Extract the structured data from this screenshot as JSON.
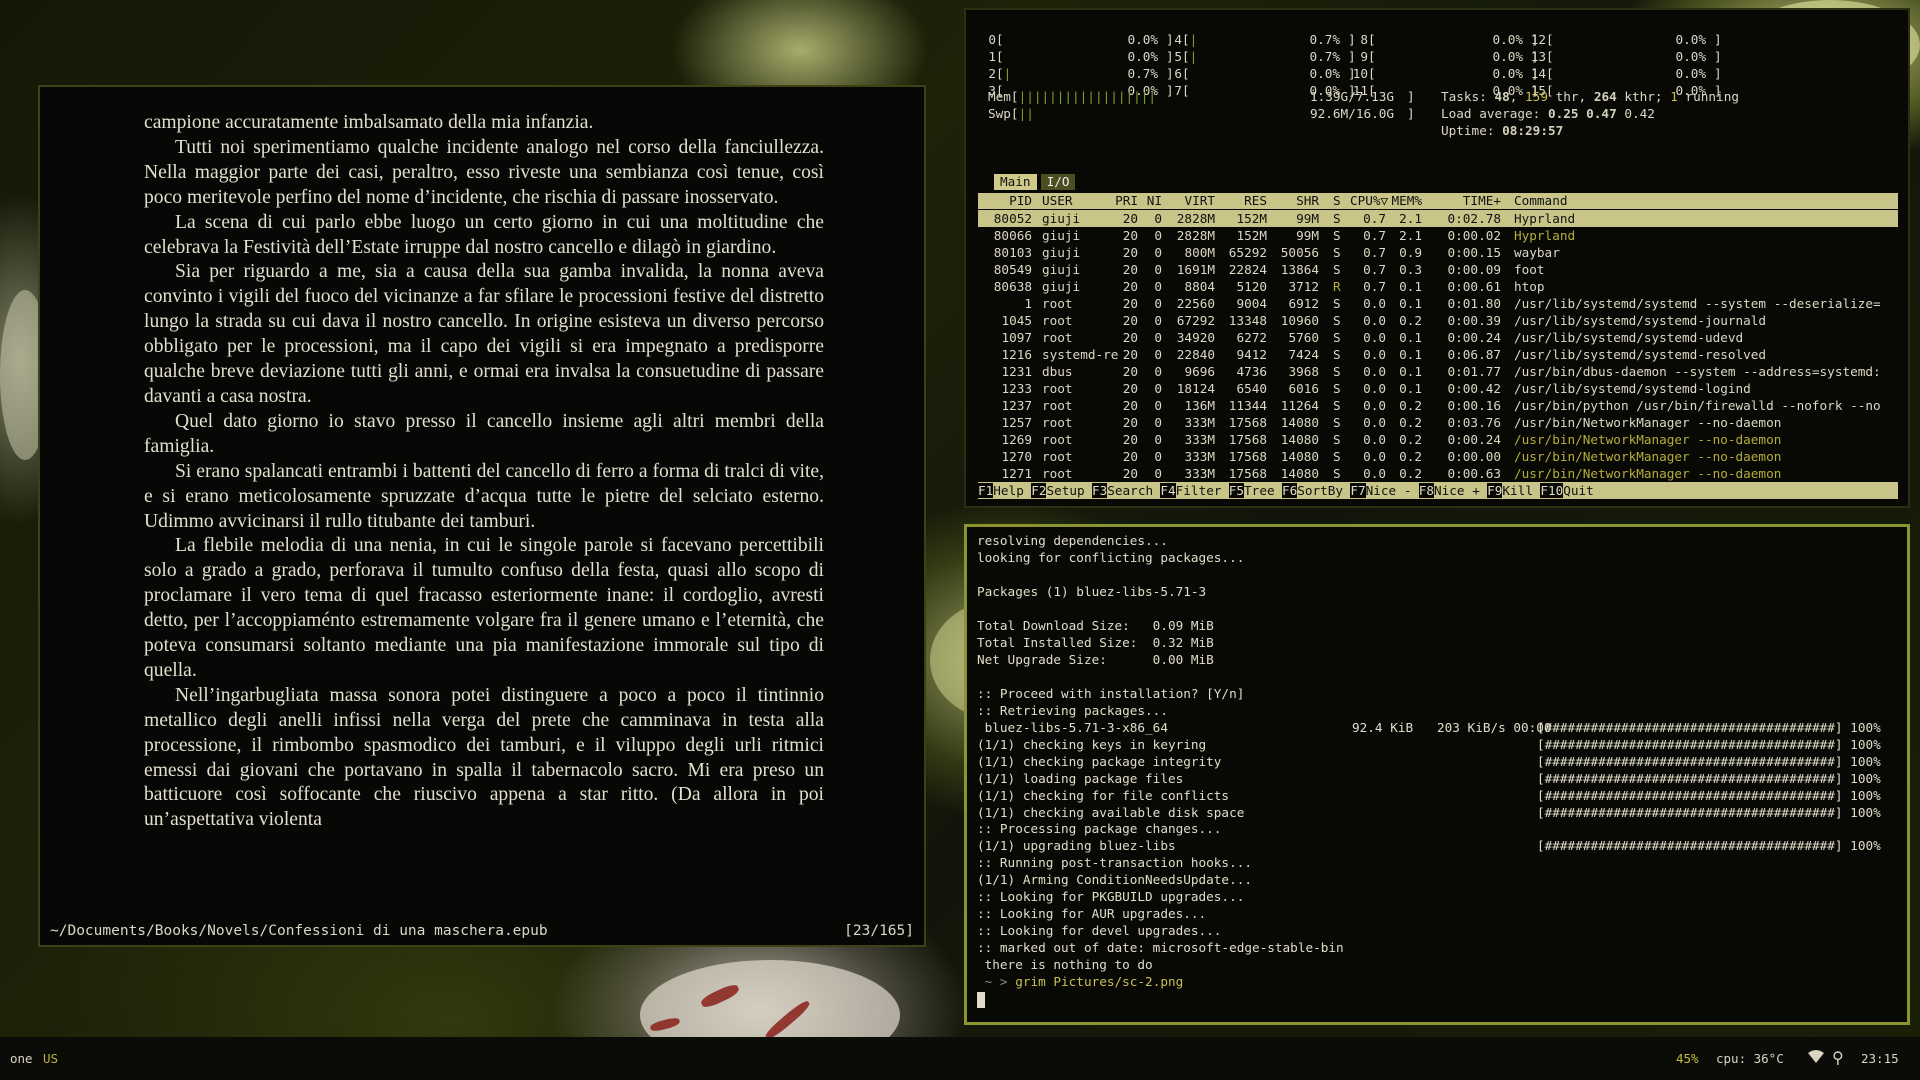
{
  "reader": {
    "paragraphs": [
      "campione accuratamente imbalsamato della mia infanzia.",
      "Tutti noi sperimentiamo qualche incidente analogo nel corso della fanciullezza. Nella maggior parte dei casi, peraltro, esso riveste una sembianza così tenue, così poco meritevole perfino del nome d’incidente, che rischia di passare inosservato.",
      "La scena di cui parlo ebbe luogo un certo giorno in cui una moltitudine che celebrava la Festività dell’Estate irruppe dal nostro cancello e dilagò in giardino.",
      "Sia per riguardo a me, sia a causa della sua gamba invalida, la nonna aveva convinto i vigili del fuoco del vicinanze a far sfilare le processioni festive del distretto lungo la strada su cui dava il nostro cancello. In origine esisteva un diverso percorso obbligato per le processioni, ma il capo dei vigili si era impegnato a predisporre qualche breve deviazione tutti gli anni, e ormai era invalsa la consuetudine di passare davanti a casa nostra.",
      "Quel dato giorno io stavo presso il cancello insieme agli altri membri della famiglia.",
      "Si erano spalancati entrambi i battenti del cancello di ferro a forma di tralci di vite, e si erano meticolosamente spruzzate d’acqua tutte le pietre del selciato esterno. Udimmo avvicinarsi il rullo titubante dei tamburi.",
      "La flebile melodia di una nenia, in cui le singole parole si facevano percettibili solo a grado a grado, perforava il tumulto confuso della festa, quasi allo scopo di proclamare il vero tema di quel fracasso esteriormente inane: il cordoglio, avresti detto, per l’accoppiaménto estremamente volgare fra il genere umano e l’eternità, che poteva consumarsi soltanto mediante una pia manifestazione immorale sul tipo di quella.",
      "Nell’ingarbugliata massa sonora potei distinguere a poco a poco il tintinnio metallico degli anelli infissi nella verga del prete che camminava in testa alla processione, il rimbombo spasmodico dei tamburi, e il viluppo degli urli ritmici emessi dai giovani che portavano in spalla il tabernacolo sacro. Mi era preso un batticuore così soffocante che riuscivo appena a star ritto. (Da allora in poi un’aspettativa violenta"
    ],
    "path": "~/Documents/Books/Novels/Confessioni di una maschera.epub",
    "page": "[23/165]"
  },
  "htop": {
    "cpus": [
      {
        "id": "0",
        "pct": "0.0%",
        "bar": ""
      },
      {
        "id": "1",
        "pct": "0.0%",
        "bar": ""
      },
      {
        "id": "2",
        "pct": "0.7%",
        "bar": "|"
      },
      {
        "id": "3",
        "pct": "0.0%",
        "bar": ""
      },
      {
        "id": "4",
        "pct": "0.7%",
        "bar": "|"
      },
      {
        "id": "5",
        "pct": "0.7%",
        "bar": "|"
      },
      {
        "id": "6",
        "pct": "0.0%",
        "bar": ""
      },
      {
        "id": "7",
        "pct": "0.0%",
        "bar": ""
      },
      {
        "id": "8",
        "pct": "0.0%",
        "bar": ""
      },
      {
        "id": "9",
        "pct": "0.0%",
        "bar": ""
      },
      {
        "id": "10",
        "pct": "0.0%",
        "bar": ""
      },
      {
        "id": "11",
        "pct": "0.0%",
        "bar": ""
      },
      {
        "id": "12",
        "pct": "0.0%",
        "bar": ""
      },
      {
        "id": "13",
        "pct": "0.0%",
        "bar": ""
      },
      {
        "id": "14",
        "pct": "0.0%",
        "bar": ""
      },
      {
        "id": "15",
        "pct": "0.0%",
        "bar": ""
      }
    ],
    "mem_label": "Mem",
    "mem_bar": "||||||||||||||||||",
    "mem_value": "1.39G/7.13G",
    "swp_label": "Swp",
    "swp_bar": "||",
    "swp_value": "92.6M/16.0G",
    "tasks_label": "Tasks:",
    "tasks": "48",
    "threads": "159",
    "thr_label": "thr,",
    "kthr": "264",
    "kthr_label": "kthr;",
    "running": "1",
    "running_label": "running",
    "load_label": "Load average:",
    "load1": "0.25",
    "load5": "0.47",
    "load15": "0.42",
    "uptime_label": "Uptime:",
    "uptime": "08:29:57",
    "tabs": [
      "Main",
      "I/O"
    ],
    "columns": [
      "PID",
      "USER",
      "PRI",
      "NI",
      "VIRT",
      "RES",
      "SHR",
      "S",
      "CPU%▽",
      "MEM%",
      "TIME+",
      "Command"
    ],
    "processes": [
      {
        "pid": "80052",
        "user": "giuji",
        "pri": "20",
        "ni": "0",
        "virt": "2828M",
        "res": "152M",
        "shr": "99M",
        "s": "S",
        "cpu": "0.7",
        "mem": "2.1",
        "time": "0:02.78",
        "cmd": "Hyprland",
        "hl": true
      },
      {
        "pid": "80066",
        "user": "giuji",
        "pri": "20",
        "ni": "0",
        "virt": "2828M",
        "res": "152M",
        "shr": "99M",
        "s": "S",
        "cpu": "0.7",
        "mem": "2.1",
        "time": "0:00.02",
        "cmd": "Hyprland",
        "thread": true
      },
      {
        "pid": "80103",
        "user": "giuji",
        "pri": "20",
        "ni": "0",
        "virt": "800M",
        "res": "65292",
        "shr": "50056",
        "s": "S",
        "cpu": "0.7",
        "mem": "0.9",
        "time": "0:00.15",
        "cmd": "waybar"
      },
      {
        "pid": "80549",
        "user": "giuji",
        "pri": "20",
        "ni": "0",
        "virt": "1691M",
        "res": "22824",
        "shr": "13864",
        "s": "S",
        "cpu": "0.7",
        "mem": "0.3",
        "time": "0:00.09",
        "cmd": "foot"
      },
      {
        "pid": "80638",
        "user": "giuji",
        "pri": "20",
        "ni": "0",
        "virt": "8804",
        "res": "5120",
        "shr": "3712",
        "s": "R",
        "cpu": "0.7",
        "mem": "0.1",
        "time": "0:00.61",
        "cmd": "htop"
      },
      {
        "pid": "1",
        "user": "root",
        "pri": "20",
        "ni": "0",
        "virt": "22560",
        "res": "9004",
        "shr": "6912",
        "s": "S",
        "cpu": "0.0",
        "mem": "0.1",
        "time": "0:01.80",
        "cmd": "/usr/lib/systemd/systemd --system --deserialize="
      },
      {
        "pid": "1045",
        "user": "root",
        "pri": "20",
        "ni": "0",
        "virt": "67292",
        "res": "13348",
        "shr": "10960",
        "s": "S",
        "cpu": "0.0",
        "mem": "0.2",
        "time": "0:00.39",
        "cmd": "/usr/lib/systemd/systemd-journald"
      },
      {
        "pid": "1097",
        "user": "root",
        "pri": "20",
        "ni": "0",
        "virt": "34920",
        "res": "6272",
        "shr": "5760",
        "s": "S",
        "cpu": "0.0",
        "mem": "0.1",
        "time": "0:00.24",
        "cmd": "/usr/lib/systemd/systemd-udevd"
      },
      {
        "pid": "1216",
        "user": "systemd-re",
        "pri": "20",
        "ni": "0",
        "virt": "22840",
        "res": "9412",
        "shr": "7424",
        "s": "S",
        "cpu": "0.0",
        "mem": "0.1",
        "time": "0:06.87",
        "cmd": "/usr/lib/systemd/systemd-resolved"
      },
      {
        "pid": "1231",
        "user": "dbus",
        "pri": "20",
        "ni": "0",
        "virt": "9696",
        "res": "4736",
        "shr": "3968",
        "s": "S",
        "cpu": "0.0",
        "mem": "0.1",
        "time": "0:01.77",
        "cmd": "/usr/bin/dbus-daemon --system --address=systemd:"
      },
      {
        "pid": "1233",
        "user": "root",
        "pri": "20",
        "ni": "0",
        "virt": "18124",
        "res": "6540",
        "shr": "6016",
        "s": "S",
        "cpu": "0.0",
        "mem": "0.1",
        "time": "0:00.42",
        "cmd": "/usr/lib/systemd/systemd-logind"
      },
      {
        "pid": "1237",
        "user": "root",
        "pri": "20",
        "ni": "0",
        "virt": "136M",
        "res": "11344",
        "shr": "11264",
        "s": "S",
        "cpu": "0.0",
        "mem": "0.2",
        "time": "0:00.16",
        "cmd": "/usr/bin/python /usr/bin/firewalld --nofork --no"
      },
      {
        "pid": "1257",
        "user": "root",
        "pri": "20",
        "ni": "0",
        "virt": "333M",
        "res": "17568",
        "shr": "14080",
        "s": "S",
        "cpu": "0.0",
        "mem": "0.2",
        "time": "0:03.76",
        "cmd": "/usr/bin/NetworkManager --no-daemon"
      },
      {
        "pid": "1269",
        "user": "root",
        "pri": "20",
        "ni": "0",
        "virt": "333M",
        "res": "17568",
        "shr": "14080",
        "s": "S",
        "cpu": "0.0",
        "mem": "0.2",
        "time": "0:00.24",
        "cmd": "/usr/bin/NetworkManager --no-daemon",
        "thread": true
      },
      {
        "pid": "1270",
        "user": "root",
        "pri": "20",
        "ni": "0",
        "virt": "333M",
        "res": "17568",
        "shr": "14080",
        "s": "S",
        "cpu": "0.0",
        "mem": "0.2",
        "time": "0:00.00",
        "cmd": "/usr/bin/NetworkManager --no-daemon",
        "thread": true
      },
      {
        "pid": "1271",
        "user": "root",
        "pri": "20",
        "ni": "0",
        "virt": "333M",
        "res": "17568",
        "shr": "14080",
        "s": "S",
        "cpu": "0.0",
        "mem": "0.2",
        "time": "0:00.63",
        "cmd": "/usr/bin/NetworkManager --no-daemon",
        "thread": true
      }
    ],
    "fkeys": [
      {
        "key": "F1",
        "label": "Help"
      },
      {
        "key": "F2",
        "label": "Setup"
      },
      {
        "key": "F3",
        "label": "Search"
      },
      {
        "key": "F4",
        "label": "Filter"
      },
      {
        "key": "F5",
        "label": "Tree"
      },
      {
        "key": "F6",
        "label": "SortBy"
      },
      {
        "key": "F7",
        "label": "Nice -"
      },
      {
        "key": "F8",
        "label": "Nice +"
      },
      {
        "key": "F9",
        "label": "Kill"
      },
      {
        "key": "F10",
        "label": "Quit"
      }
    ]
  },
  "terminal": {
    "lines": [
      {
        "text": "resolving dependencies..."
      },
      {
        "text": "looking for conflicting packages..."
      },
      {
        "text": ""
      },
      {
        "text": "Packages (1) bluez-libs-5.71-3"
      },
      {
        "text": ""
      },
      {
        "text": "Total Download Size:   0.09 MiB"
      },
      {
        "text": "Total Installed Size:  0.32 MiB"
      },
      {
        "text": "Net Upgrade Size:      0.00 MiB"
      },
      {
        "text": ""
      },
      {
        "text": ":: Proceed with installation? [Y/n]"
      },
      {
        "text": ":: Retrieving packages..."
      },
      {
        "text": " bluez-libs-5.71-3-x86_64",
        "size": "92.4 KiB",
        "rate": "203 KiB/s 00:00",
        "progress": "[######################################] 100%"
      },
      {
        "text": "(1/1) checking keys in keyring",
        "progress": "[######################################] 100%"
      },
      {
        "text": "(1/1) checking package integrity",
        "progress": "[######################################] 100%"
      },
      {
        "text": "(1/1) loading package files",
        "progress": "[######################################] 100%"
      },
      {
        "text": "(1/1) checking for file conflicts",
        "progress": "[######################################] 100%"
      },
      {
        "text": "(1/1) checking available disk space",
        "progress": "[######################################] 100%"
      },
      {
        "text": ":: Processing package changes..."
      },
      {
        "text": "(1/1) upgrading bluez-libs",
        "progress": "[######################################] 100%"
      },
      {
        "text": ":: Running post-transaction hooks..."
      },
      {
        "text": "(1/1) Arming ConditionNeedsUpdate..."
      },
      {
        "text": ":: Looking for PKGBUILD upgrades..."
      },
      {
        "text": ":: Looking for AUR upgrades..."
      },
      {
        "text": ":: Looking for devel upgrades..."
      },
      {
        "text": ":: marked out of date: microsoft-edge-stable-bin"
      },
      {
        "text": " there is nothing to do"
      }
    ],
    "prompt_symbol": " ~ >",
    "prompt_command": "grim Pictures/sc-2.png"
  },
  "statusbar": {
    "workspace": "one",
    "keyboard_layout": "US",
    "battery": "45%",
    "cpu_temp": "cpu: 36°C",
    "clock": "23:15",
    "wifi_icon": "wifi-icon",
    "usb_icon": "usb-icon"
  }
}
